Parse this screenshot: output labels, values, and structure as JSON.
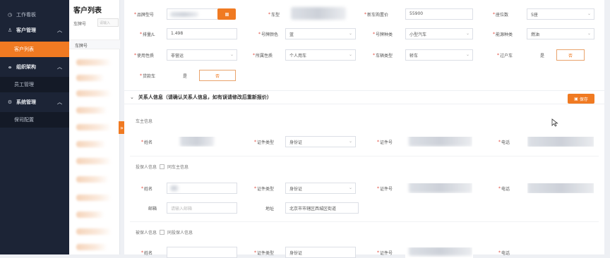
{
  "sidebar": {
    "dashboard": "工作看板",
    "customer_mgmt": "客户管理",
    "customer_list": "客户列表",
    "org": "组织架构",
    "employee_mgmt": "员工管理",
    "system_mgmt": "系统管理",
    "insurance_config": "保司配置"
  },
  "list_panel": {
    "title": "客户列表",
    "filter_label": "车牌号",
    "filter_placeholder": "请输入",
    "column_header": "车牌号"
  },
  "vehicle_form": {
    "brand_model_label": "品牌型号",
    "car_model_label": "车型",
    "new_car_price_label": "新车购置价",
    "new_car_price_value": "55900",
    "seats_label": "座位数",
    "seats_value": "5座",
    "displacement_label": "排量/L",
    "displacement_value": "1.498",
    "plate_color_label": "号牌颜色",
    "plate_color_value": "蓝",
    "plate_type_label": "号牌种类",
    "plate_type_value": "小型汽车",
    "energy_type_label": "能源种类",
    "energy_type_value": "燃油",
    "usage_label": "使用性质",
    "usage_value": "非营运",
    "owner_type_label": "所属性质",
    "owner_type_value": "个人用车",
    "vehicle_type_label": "车辆类型",
    "vehicle_type_value": "轿车",
    "transfer_label": "过户车",
    "transfer_yes": "是",
    "transfer_no": "否",
    "loan_label": "贷款车",
    "loan_yes": "是",
    "loan_no": "否"
  },
  "contact_section": {
    "title": "关系人信息（请确认关系人信息，如有误请修改后重新报价）",
    "save_label": "保存",
    "owner_group": "车主信息",
    "insured_group": "投保人信息",
    "insured_same_as": "同车主信息",
    "beneficiary_group": "被保人信息",
    "beneficiary_same_as": "同投保人信息",
    "name_label": "姓名",
    "id_type_label": "证件类型",
    "id_type_value": "身份证",
    "id_no_label": "证件号",
    "phone_label": "电话",
    "email_label": "邮箱",
    "email_placeholder": "请输入邮箱",
    "address_label": "地址",
    "address_value": "北京市市辖区西城区街道"
  },
  "colors": {
    "accent": "#f07a22",
    "sidebar_bg": "#1c2436"
  }
}
